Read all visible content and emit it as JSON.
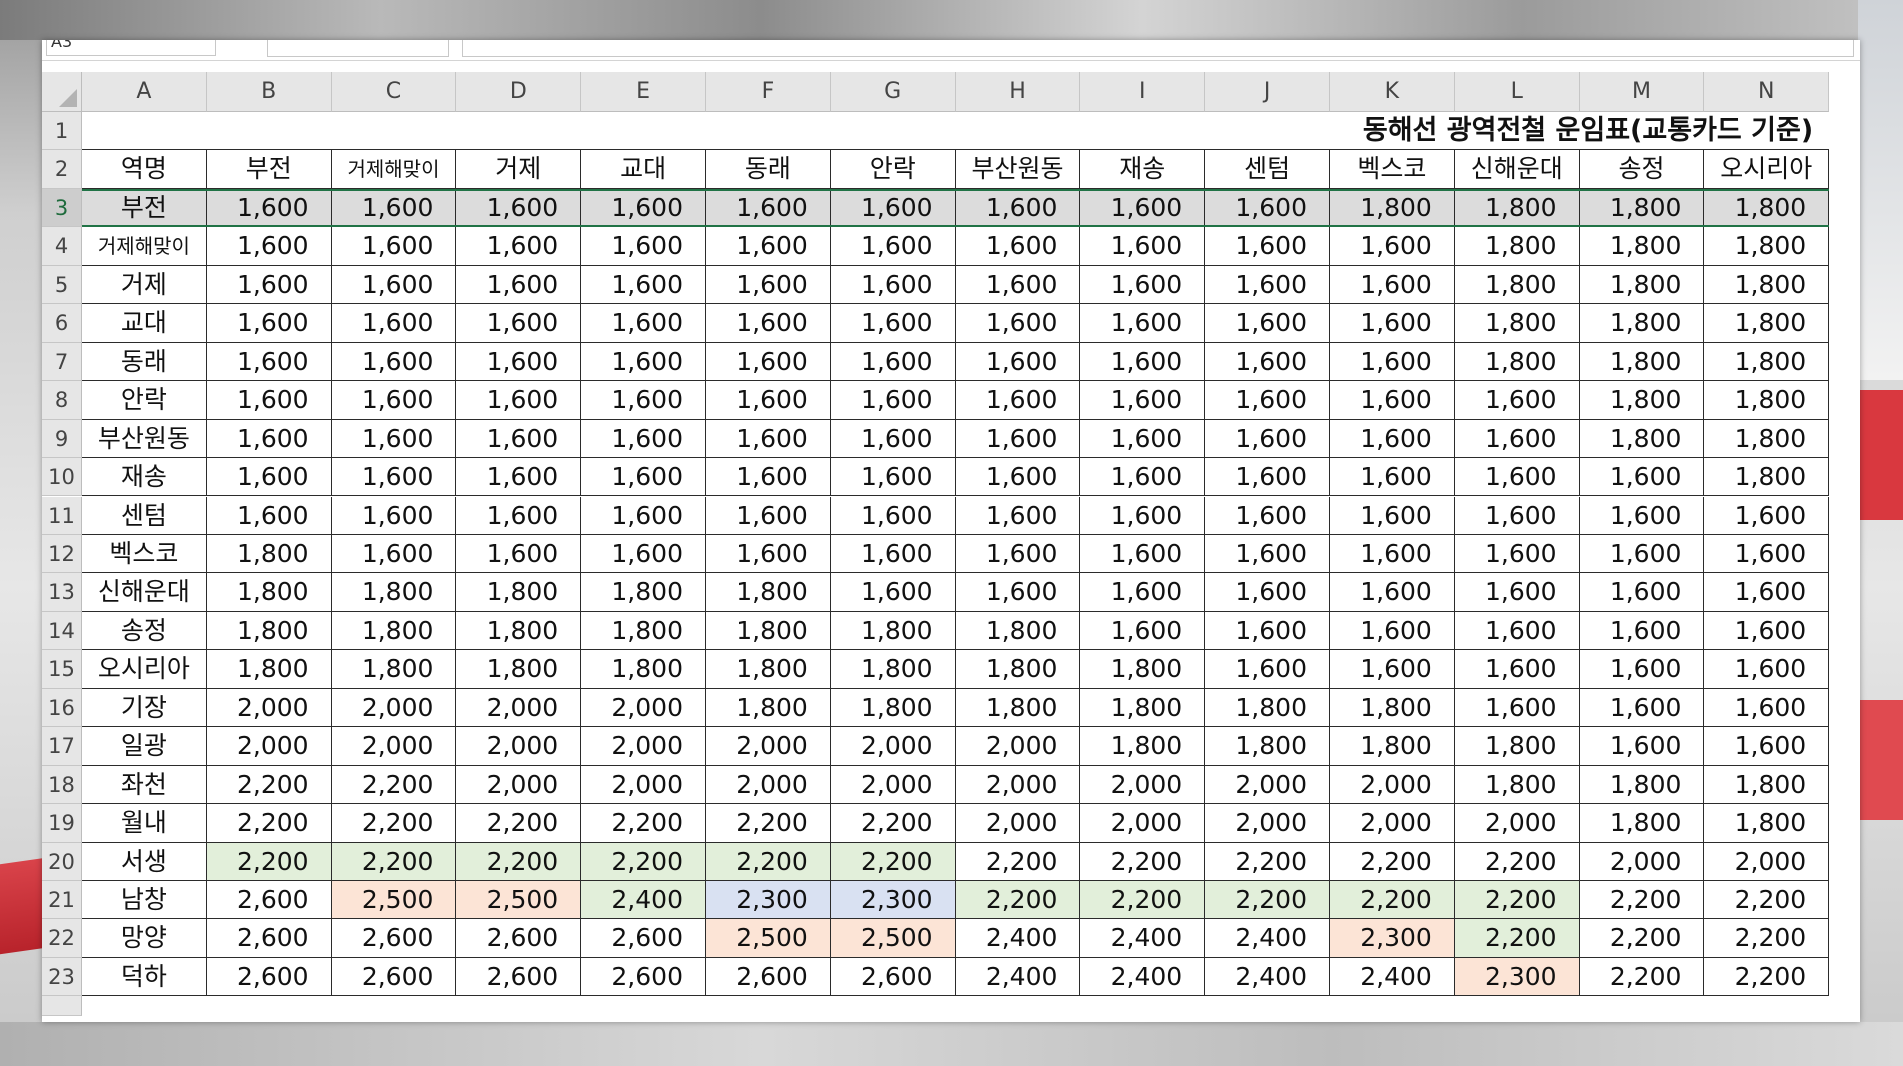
{
  "formula_bar": {
    "name_box": "A3"
  },
  "sheet": {
    "columns": [
      "A",
      "B",
      "C",
      "D",
      "E",
      "F",
      "G",
      "H",
      "I",
      "J",
      "K",
      "L",
      "M",
      "N"
    ],
    "title": "동해선 광역전철 운임표(교통카드 기준)",
    "header_label": "역명",
    "stations": [
      "부전",
      "거제해맞이",
      "거제",
      "교대",
      "동래",
      "안락",
      "부산원동",
      "재송",
      "센텀",
      "벡스코",
      "신해운대",
      "송정",
      "오시리아"
    ],
    "rows": [
      {
        "num": "3",
        "name": "부전",
        "values": [
          "1,600",
          "1,600",
          "1,600",
          "1,600",
          "1,600",
          "1,600",
          "1,600",
          "1,600",
          "1,600",
          "1,800",
          "1,800",
          "1,800",
          "1,800"
        ]
      },
      {
        "num": "4",
        "name": "거제해맞이",
        "values": [
          "1,600",
          "1,600",
          "1,600",
          "1,600",
          "1,600",
          "1,600",
          "1,600",
          "1,600",
          "1,600",
          "1,600",
          "1,800",
          "1,800",
          "1,800"
        ]
      },
      {
        "num": "5",
        "name": "거제",
        "values": [
          "1,600",
          "1,600",
          "1,600",
          "1,600",
          "1,600",
          "1,600",
          "1,600",
          "1,600",
          "1,600",
          "1,600",
          "1,800",
          "1,800",
          "1,800"
        ]
      },
      {
        "num": "6",
        "name": "교대",
        "values": [
          "1,600",
          "1,600",
          "1,600",
          "1,600",
          "1,600",
          "1,600",
          "1,600",
          "1,600",
          "1,600",
          "1,600",
          "1,800",
          "1,800",
          "1,800"
        ]
      },
      {
        "num": "7",
        "name": "동래",
        "values": [
          "1,600",
          "1,600",
          "1,600",
          "1,600",
          "1,600",
          "1,600",
          "1,600",
          "1,600",
          "1,600",
          "1,600",
          "1,800",
          "1,800",
          "1,800"
        ]
      },
      {
        "num": "8",
        "name": "안락",
        "values": [
          "1,600",
          "1,600",
          "1,600",
          "1,600",
          "1,600",
          "1,600",
          "1,600",
          "1,600",
          "1,600",
          "1,600",
          "1,600",
          "1,800",
          "1,800"
        ]
      },
      {
        "num": "9",
        "name": "부산원동",
        "values": [
          "1,600",
          "1,600",
          "1,600",
          "1,600",
          "1,600",
          "1,600",
          "1,600",
          "1,600",
          "1,600",
          "1,600",
          "1,600",
          "1,800",
          "1,800"
        ]
      },
      {
        "num": "10",
        "name": "재송",
        "values": [
          "1,600",
          "1,600",
          "1,600",
          "1,600",
          "1,600",
          "1,600",
          "1,600",
          "1,600",
          "1,600",
          "1,600",
          "1,600",
          "1,600",
          "1,800"
        ]
      },
      {
        "num": "11",
        "name": "센텀",
        "values": [
          "1,600",
          "1,600",
          "1,600",
          "1,600",
          "1,600",
          "1,600",
          "1,600",
          "1,600",
          "1,600",
          "1,600",
          "1,600",
          "1,600",
          "1,600"
        ]
      },
      {
        "num": "12",
        "name": "벡스코",
        "values": [
          "1,800",
          "1,600",
          "1,600",
          "1,600",
          "1,600",
          "1,600",
          "1,600",
          "1,600",
          "1,600",
          "1,600",
          "1,600",
          "1,600",
          "1,600"
        ]
      },
      {
        "num": "13",
        "name": "신해운대",
        "values": [
          "1,800",
          "1,800",
          "1,800",
          "1,800",
          "1,800",
          "1,600",
          "1,600",
          "1,600",
          "1,600",
          "1,600",
          "1,600",
          "1,600",
          "1,600"
        ]
      },
      {
        "num": "14",
        "name": "송정",
        "values": [
          "1,800",
          "1,800",
          "1,800",
          "1,800",
          "1,800",
          "1,800",
          "1,800",
          "1,600",
          "1,600",
          "1,600",
          "1,600",
          "1,600",
          "1,600"
        ]
      },
      {
        "num": "15",
        "name": "오시리아",
        "values": [
          "1,800",
          "1,800",
          "1,800",
          "1,800",
          "1,800",
          "1,800",
          "1,800",
          "1,800",
          "1,600",
          "1,600",
          "1,600",
          "1,600",
          "1,600"
        ]
      },
      {
        "num": "16",
        "name": "기장",
        "values": [
          "2,000",
          "2,000",
          "2,000",
          "2,000",
          "1,800",
          "1,800",
          "1,800",
          "1,800",
          "1,800",
          "1,800",
          "1,600",
          "1,600",
          "1,600"
        ]
      },
      {
        "num": "17",
        "name": "일광",
        "values": [
          "2,000",
          "2,000",
          "2,000",
          "2,000",
          "2,000",
          "2,000",
          "2,000",
          "1,800",
          "1,800",
          "1,800",
          "1,800",
          "1,600",
          "1,600"
        ]
      },
      {
        "num": "18",
        "name": "좌천",
        "values": [
          "2,200",
          "2,200",
          "2,000",
          "2,000",
          "2,000",
          "2,000",
          "2,000",
          "2,000",
          "2,000",
          "2,000",
          "1,800",
          "1,800",
          "1,800"
        ]
      },
      {
        "num": "19",
        "name": "월내",
        "values": [
          "2,200",
          "2,200",
          "2,200",
          "2,200",
          "2,200",
          "2,200",
          "2,000",
          "2,000",
          "2,000",
          "2,000",
          "2,000",
          "1,800",
          "1,800"
        ]
      },
      {
        "num": "20",
        "name": "서생",
        "values": [
          "2,200",
          "2,200",
          "2,200",
          "2,200",
          "2,200",
          "2,200",
          "2,200",
          "2,200",
          "2,200",
          "2,200",
          "2,200",
          "2,000",
          "2,000"
        ]
      },
      {
        "num": "21",
        "name": "남창",
        "values": [
          "2,600",
          "2,500",
          "2,500",
          "2,400",
          "2,300",
          "2,300",
          "2,200",
          "2,200",
          "2,200",
          "2,200",
          "2,200",
          "2,200",
          "2,200"
        ]
      },
      {
        "num": "22",
        "name": "망양",
        "values": [
          "2,600",
          "2,600",
          "2,600",
          "2,600",
          "2,500",
          "2,500",
          "2,400",
          "2,400",
          "2,400",
          "2,300",
          "2,200",
          "2,200",
          "2,200"
        ]
      },
      {
        "num": "23",
        "name": "덕하",
        "values": [
          "2,600",
          "2,600",
          "2,600",
          "2,600",
          "2,600",
          "2,600",
          "2,400",
          "2,400",
          "2,400",
          "2,400",
          "2,300",
          "2,200",
          "2,200"
        ]
      }
    ],
    "highlights": {
      "20": [
        "g",
        "g",
        "g",
        "g",
        "g",
        "g",
        "",
        "",
        "",
        "",
        "",
        "",
        ""
      ],
      "21": [
        "",
        "p",
        "p",
        "g",
        "b",
        "b",
        "g",
        "g",
        "g",
        "g",
        "g",
        "",
        ""
      ],
      "22": [
        "",
        "",
        "",
        "",
        "p",
        "p",
        "",
        "",
        "",
        "p",
        "g",
        "",
        ""
      ],
      "23": [
        "",
        "",
        "",
        "",
        "",
        "",
        "",
        "",
        "",
        "",
        "p",
        "",
        ""
      ]
    },
    "highlight_colors": {
      "g": "#e2efda",
      "p": "#fce4d6",
      "b": "#d9e1f2"
    },
    "selected_row": "3",
    "accent_color": "#217346"
  }
}
